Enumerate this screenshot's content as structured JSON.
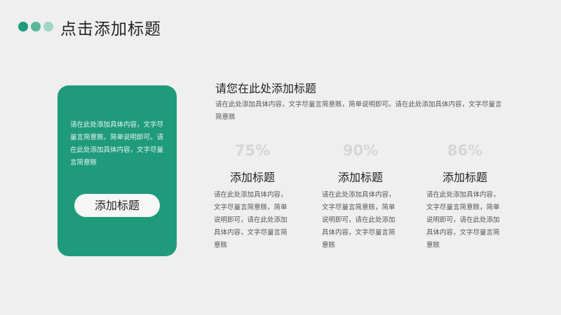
{
  "header": {
    "title": "点击添加标题"
  },
  "card": {
    "text": "请在此处添加具体内容，文字尽量言简意赅，简单说明即可。请在此处添加具体内容，文字尽量言简意赅",
    "button_label": "添加标题"
  },
  "section": {
    "title": "请您在此处添加标题",
    "description": "请在此处添加具体内容，文字尽量言简意赅，简单说明即可。请在此处添加具体内容，文字尽量言简意赅"
  },
  "columns": [
    {
      "percent": "75%",
      "title": "添加标题",
      "body": "请在此处添加具体内容，文字尽量言简意赅，简单说明即可，请在此处添加具体内容，文字尽量言简意赅"
    },
    {
      "percent": "90%",
      "title": "添加标题",
      "body": "请在此处添加具体内容，文字尽量言简意赅，简单说明即可，请在此处添加具体内容，文字尽量言简意赅"
    },
    {
      "percent": "86%",
      "title": "添加标题",
      "body": "请在此处添加具体内容，文字尽量言简意赅，简单说明即可，请在此处添加具体内容，文字尽量言简意赅"
    }
  ],
  "colors": {
    "accent": "#1f9b7c",
    "accent_mid": "#58b79b",
    "accent_light": "#9fd6c4",
    "background": "#efefef",
    "percent_text": "#d6d6d6"
  }
}
